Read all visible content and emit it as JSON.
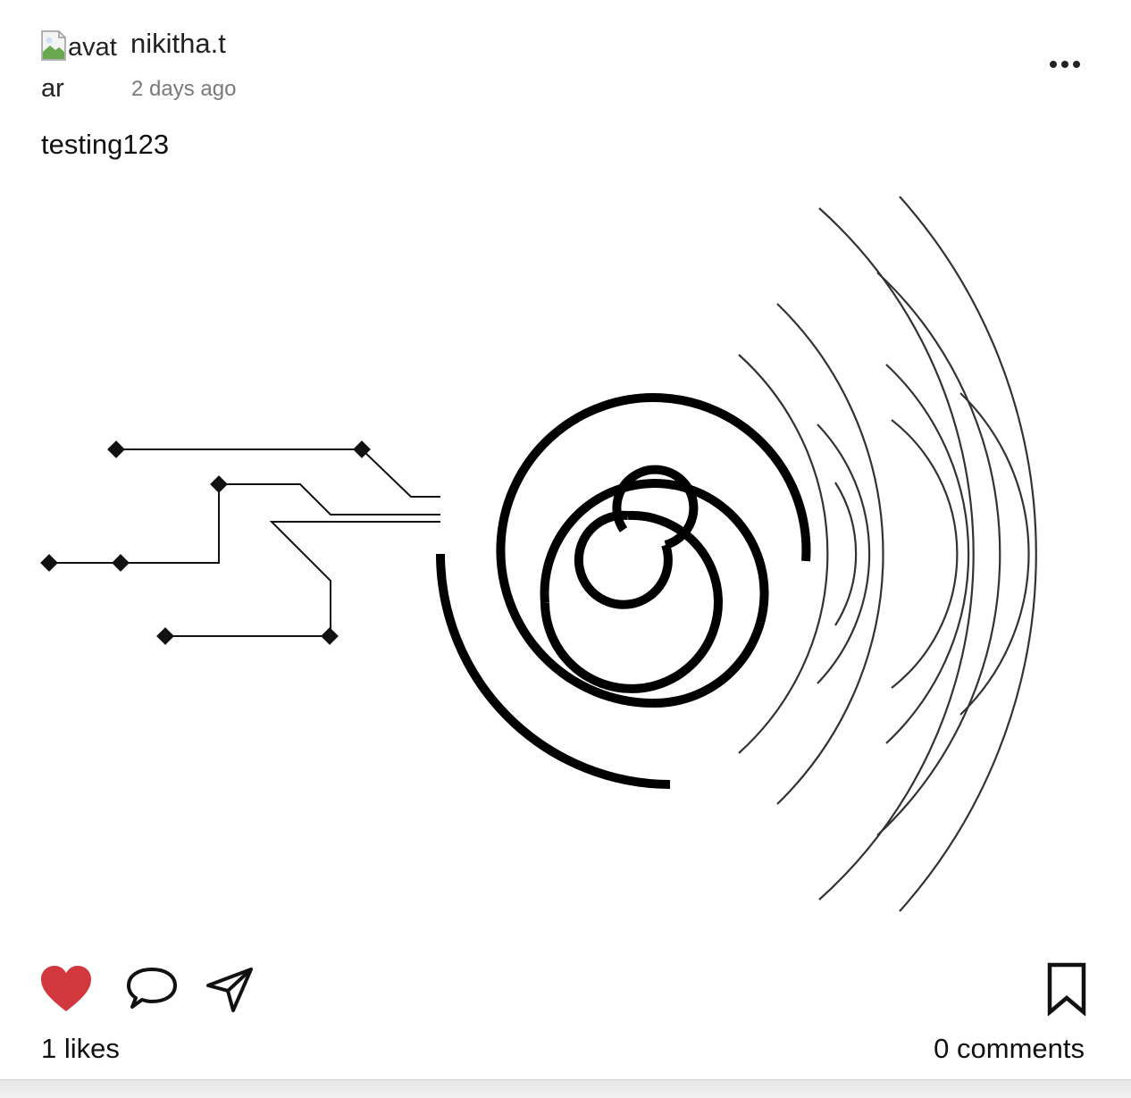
{
  "post": {
    "avatar_alt_line1": "avat",
    "avatar_alt_line2": "ar",
    "username": "nikitha.t",
    "timestamp": "2 days ago",
    "caption": "testing123",
    "image_icon": "spiral-circuit-artwork"
  },
  "actions": {
    "like_icon": "heart-icon",
    "like_color": "#d2373e",
    "liked": true,
    "comment_icon": "speech-bubble-icon",
    "share_icon": "paper-plane-icon",
    "bookmark_icon": "bookmark-icon",
    "more_icon": "ellipsis-icon"
  },
  "stats": {
    "likes_text": "1 likes",
    "comments_text": "0 comments"
  }
}
